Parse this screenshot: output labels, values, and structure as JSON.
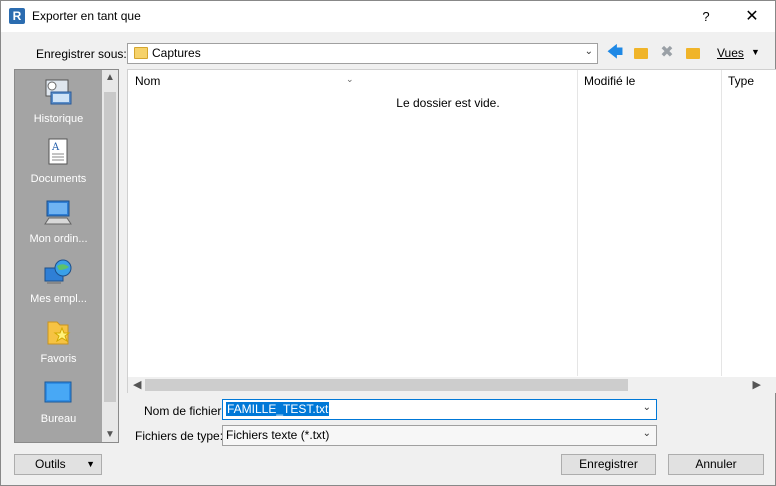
{
  "window": {
    "title": "Exporter en tant que",
    "help_label": "?",
    "close_label": "✕"
  },
  "toolbar": {
    "save_in_label": "Enregistrer sous:",
    "location_value": "Captures",
    "views_label": "Vues"
  },
  "places": [
    {
      "label": "Historique",
      "icon": "history-icon"
    },
    {
      "label": "Documents",
      "icon": "documents-icon"
    },
    {
      "label": "Mon ordin...",
      "icon": "computer-icon"
    },
    {
      "label": "Mes empl...",
      "icon": "network-places-icon"
    },
    {
      "label": "Favoris",
      "icon": "favorites-icon"
    },
    {
      "label": "Bureau",
      "icon": "desktop-icon"
    }
  ],
  "filelist": {
    "columns": [
      "Nom",
      "Modifié le",
      "Type"
    ],
    "empty_message": "Le dossier est vide."
  },
  "form": {
    "filename_label": "Nom de fichier:",
    "filename_value": "FAMILLE_TEST.txt",
    "filetype_label": "Fichiers de type:",
    "filetype_value": "Fichiers texte  (*.txt)"
  },
  "buttons": {
    "tools_label": "Outils",
    "save_label": "Enregistrer",
    "cancel_label": "Annuler"
  },
  "colors": {
    "accent": "#0078d7",
    "places_bg": "#a4a4a4"
  }
}
